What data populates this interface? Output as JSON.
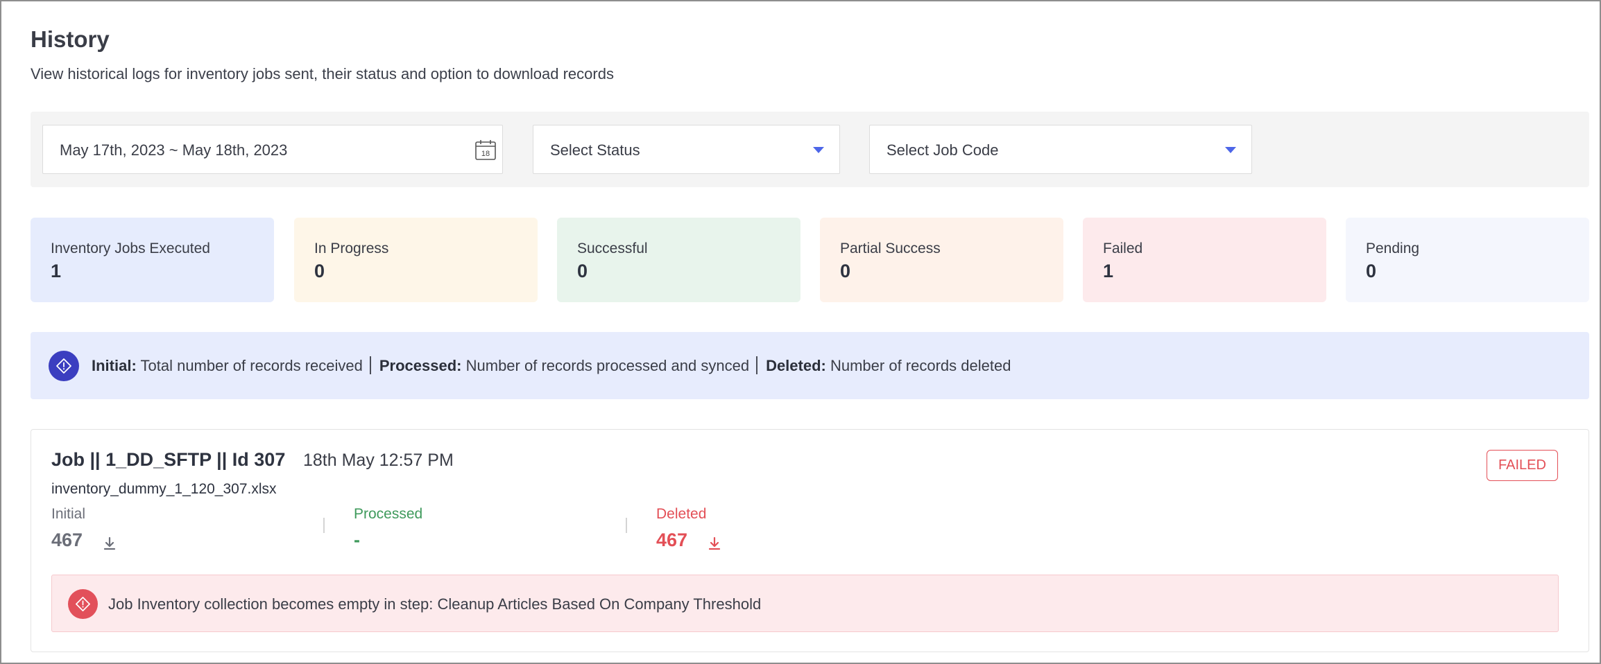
{
  "header": {
    "title": "History",
    "subtitle": "View historical logs for inventory jobs sent, their status and option to download records"
  },
  "filters": {
    "date_range": "May 17th, 2023 ~ May 18th, 2023",
    "calendar_day": "18",
    "status_placeholder": "Select Status",
    "job_code_placeholder": "Select Job Code",
    "accent_color": "#4d66e8"
  },
  "stats": [
    {
      "label": "Inventory Jobs Executed",
      "value": "1",
      "color": "#e6ecfd"
    },
    {
      "label": "In Progress",
      "value": "0",
      "color": "#fef6e8"
    },
    {
      "label": "Successful",
      "value": "0",
      "color": "#e8f4ec"
    },
    {
      "label": "Partial Success",
      "value": "0",
      "color": "#fef2ea"
    },
    {
      "label": "Failed",
      "value": "1",
      "color": "#fdeaec"
    },
    {
      "label": "Pending",
      "value": "0",
      "color": "#f4f6fd"
    }
  ],
  "legend": {
    "icon": "info-diamond-icon",
    "initial_term": "Initial:",
    "initial_desc": "Total number of records received",
    "processed_term": "Processed:",
    "processed_desc": "Number of records processed and synced",
    "deleted_term": "Deleted:",
    "deleted_desc": "Number of records deleted"
  },
  "job": {
    "title": "Job || 1_DD_SFTP || Id 307",
    "time": "18th May 12:57 PM",
    "file": "inventory_dummy_1_120_307.xlsx",
    "status": "FAILED",
    "status_color": "#e34f56",
    "initial_label": "Initial",
    "initial_value": "467",
    "processed_label": "Processed",
    "processed_value": "-",
    "deleted_label": "Deleted",
    "deleted_value": "467",
    "error_icon": "error-diamond-icon",
    "error_message": "Job Inventory collection becomes empty in step: Cleanup Articles Based On Company Threshold"
  }
}
